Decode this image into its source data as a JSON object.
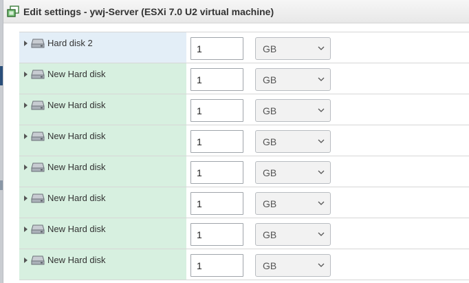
{
  "window": {
    "title": "Edit settings - ywj-Server (ESXi 7.0 U2 virtual machine)",
    "icon": "vm-settings-icon"
  },
  "colors": {
    "row_label_bg": "#d7f0e0",
    "row_selected_bg": "#e3eef7",
    "titlebar_bg": "#eeeeee",
    "select_bg": "#f2f2f2"
  },
  "disks": [
    {
      "label": "Hard disk 2",
      "size": "1",
      "unit": "GB",
      "selected": true
    },
    {
      "label": "New Hard disk",
      "size": "1",
      "unit": "GB",
      "selected": false
    },
    {
      "label": "New Hard disk",
      "size": "1",
      "unit": "GB",
      "selected": false
    },
    {
      "label": "New Hard disk",
      "size": "1",
      "unit": "GB",
      "selected": false
    },
    {
      "label": "New Hard disk",
      "size": "1",
      "unit": "GB",
      "selected": false
    },
    {
      "label": "New Hard disk",
      "size": "1",
      "unit": "GB",
      "selected": false
    },
    {
      "label": "New Hard disk",
      "size": "1",
      "unit": "GB",
      "selected": false
    },
    {
      "label": "New Hard disk",
      "size": "1",
      "unit": "GB",
      "selected": false
    }
  ]
}
